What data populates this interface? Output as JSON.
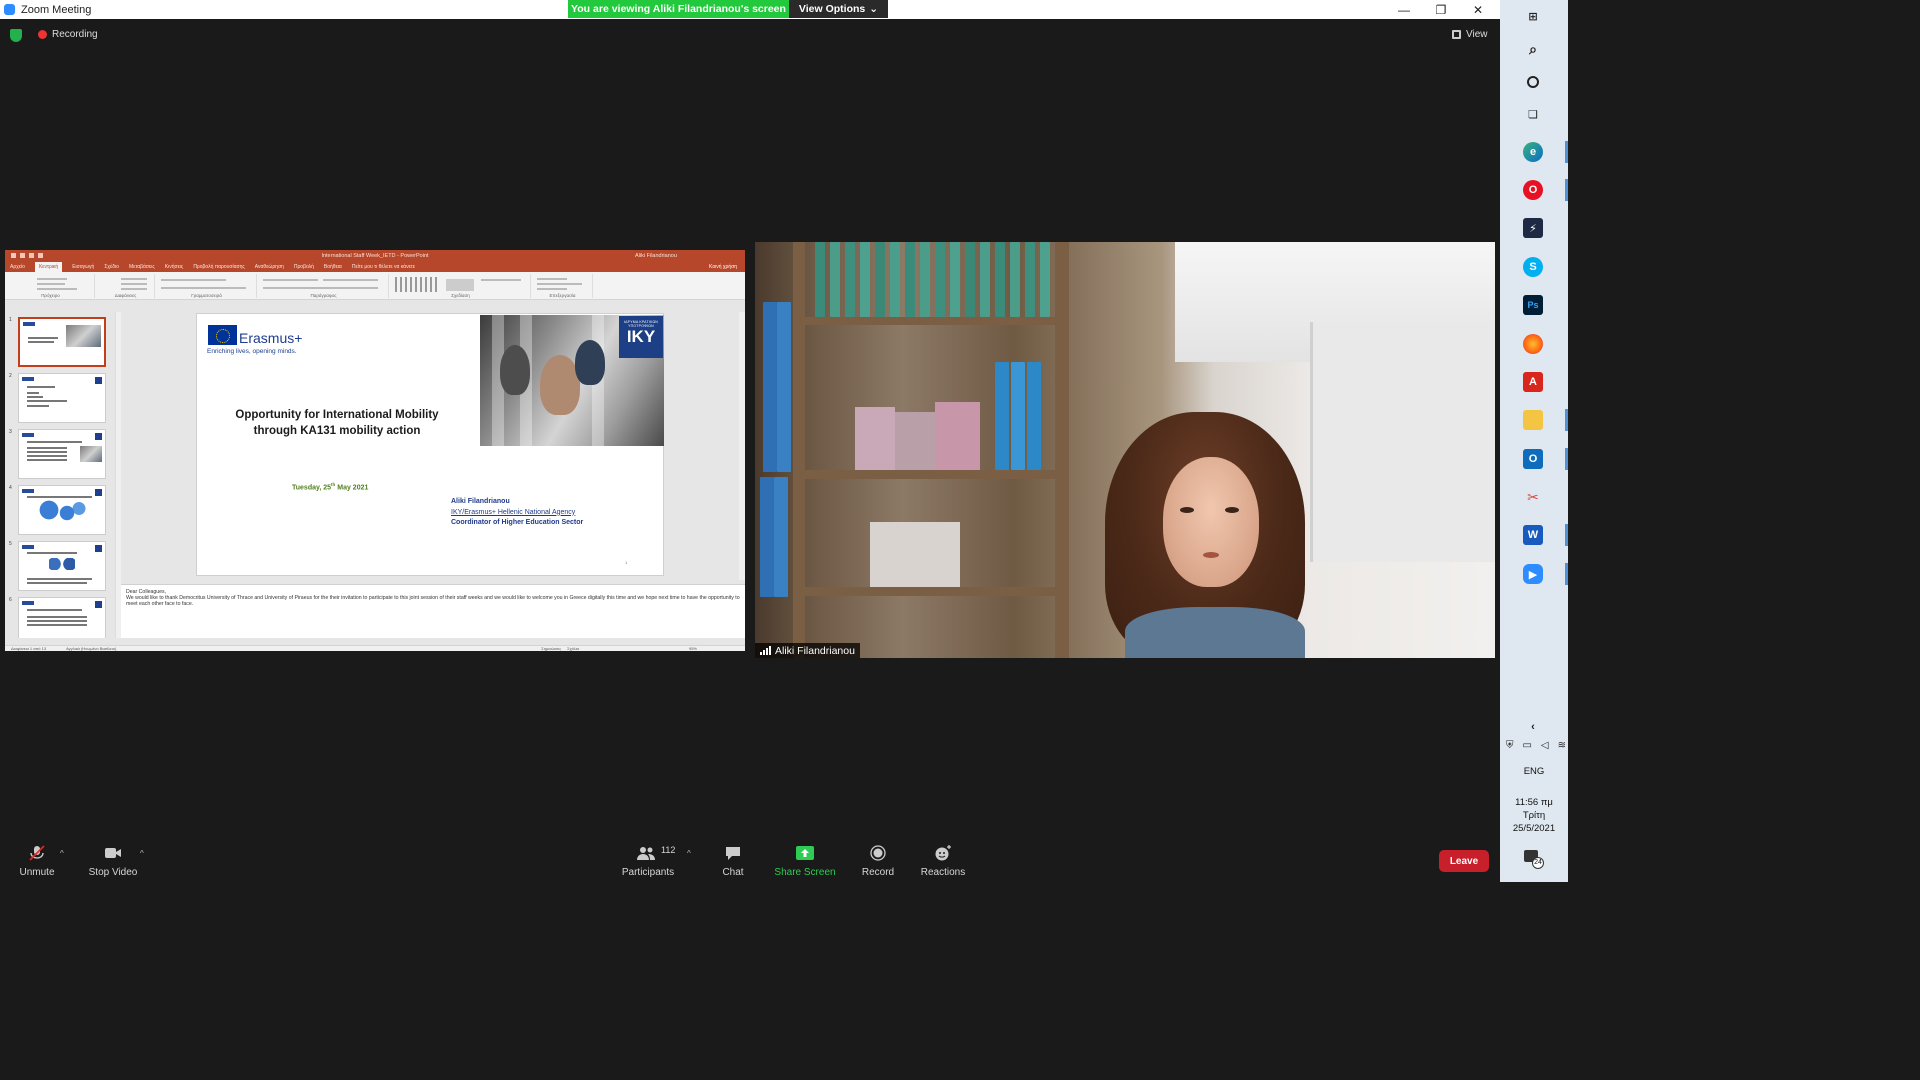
{
  "window": {
    "title": "Zoom Meeting",
    "viewing_banner": "You are viewing Aliki Filandrianou's screen",
    "view_options_label": "View Options",
    "minimize": "—",
    "restore": "❐",
    "close": "✕"
  },
  "meeting": {
    "recording_label": "Recording",
    "view_label": "View"
  },
  "powerpoint": {
    "title_text": "International Staff Week_IETD   -   PowerPoint",
    "user_text": "Aliki Filandrianou",
    "tabs": [
      "Αρχείο",
      "Κεντρική",
      "Εισαγωγή",
      "Σχέδιο",
      "Μεταβάσεις",
      "Κινήσεις",
      "Προβολή παρουσίασης",
      "Αναθεώρηση",
      "Προβολή",
      "Βοήθεια",
      "Πείτε μου τι θέλετε να κάνετε"
    ],
    "share_label": "Κοινή χρήση",
    "ribbon_groups": [
      "Πρόχειρο",
      "Διαφάνειες",
      "Γραμματοσειρά",
      "Παράγραφος",
      "Σχεδίαση",
      "Επεξεργασία"
    ],
    "slide_numbers": [
      "1",
      "2",
      "3",
      "4",
      "5",
      "6"
    ],
    "slide": {
      "brand": "Erasmus+",
      "tagline": "Enriching lives, opening minds.",
      "iky_small": "ΙΔΡΥΜΑ ΚΡΑΤΙΚΩΝ ΥΠΟΤΡΟΦΙΩΝ",
      "iky_big": "IKY",
      "heading_line1": "Opportunity for International Mobility",
      "heading_line2": "through KA131 mobility action",
      "date_prefix": "Tuesday, 25",
      "date_sup": "th",
      "date_suffix": " May  2021",
      "author_name": "Aliki Filandrianou",
      "author_org": "IKY/Erasmus+ Hellenic National Agency",
      "author_role": "Coordinator of Higher Education Sector",
      "page_number": "1"
    },
    "notes": {
      "line1": "Dear Colleagues,",
      "line2": "We would like to thank Democritus University of Thrace and University of Piraeus for the their invitation to participate to this joint session of their staff weeks and we would like to welcome you in Greece digitally this time and we hope next time to have the opportunity to meet each other face to face."
    },
    "status_left": "Διαφάνεια 1 από 13",
    "status_lang": "Αγγλικά (Ηνωμένο Βασίλειο)",
    "status_notes": "Σημειώσεις",
    "status_comments": "Σχόλια",
    "status_zoom": "95%"
  },
  "video": {
    "participant_name": "Aliki Filandrianou"
  },
  "toolbar": {
    "unmute": "Unmute",
    "stop_video": "Stop Video",
    "participants_count": "112",
    "participants": "Participants",
    "chat": "Chat",
    "share_screen": "Share Screen",
    "record": "Record",
    "reactions": "Reactions",
    "leave": "Leave"
  },
  "taskbar": {
    "language": "ENG",
    "time": "11:56 πμ",
    "day": "Τρίτη",
    "date": "25/5/2021",
    "notifications_count": "24"
  },
  "colors": {
    "zoom_green": "#23c93c",
    "leave_red": "#c7202b",
    "ppt_orange": "#b7472a",
    "erasmus_blue": "#1e3d8f"
  }
}
